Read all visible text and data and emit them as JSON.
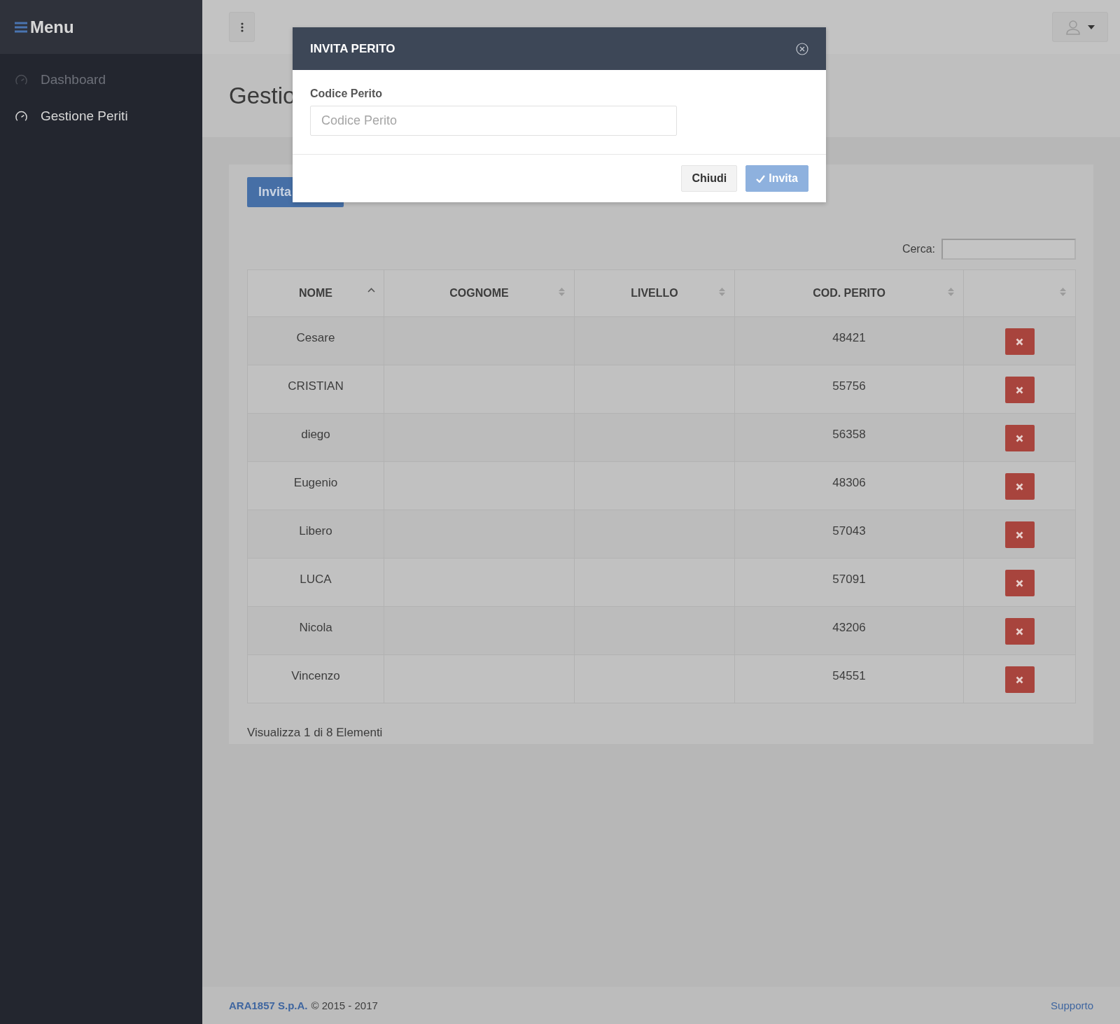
{
  "sidebar": {
    "title": "Menu",
    "items": [
      {
        "label": "Dashboard",
        "selected": false
      },
      {
        "label": "Gestione Periti",
        "selected": true
      }
    ]
  },
  "page": {
    "title": "Gestio",
    "invite_button": "Invita"
  },
  "search": {
    "label": "Cerca:"
  },
  "table": {
    "columns": [
      {
        "label": "NOME",
        "sorted": true
      },
      {
        "label": "COGNOME",
        "sorted": false
      },
      {
        "label": "LIVELLO",
        "sorted": false
      },
      {
        "label": "COD. PERITO",
        "sorted": false
      },
      {
        "sorted": false
      }
    ],
    "rows": [
      {
        "nome": "Cesare",
        "cod_perito": "48421"
      },
      {
        "nome": "CRISTIAN",
        "cod_perito": "55756"
      },
      {
        "nome": "diego",
        "cod_perito": "56358"
      },
      {
        "nome": "Eugenio",
        "cod_perito": "48306"
      },
      {
        "nome": "Libero",
        "cod_perito": "57043"
      },
      {
        "nome": "LUCA",
        "cod_perito": "57091"
      },
      {
        "nome": "Nicola",
        "cod_perito": "43206"
      },
      {
        "nome": "Vincenzo",
        "cod_perito": "54551"
      }
    ],
    "info": "Visualizza 1 di 8 Elementi"
  },
  "modal": {
    "title": "INVITA PERITO",
    "field_label": "Codice Perito",
    "placeholder": "Codice Perito",
    "buttons": [
      {
        "label": "Chiudi",
        "kind": "default",
        "disabled": false
      },
      {
        "label": "Invita",
        "kind": "primary",
        "disabled": true
      }
    ]
  },
  "footer": {
    "company": "ARA1857 S.p.A.",
    "copyright": "© 2015 - 2017",
    "link": "Supporto"
  }
}
